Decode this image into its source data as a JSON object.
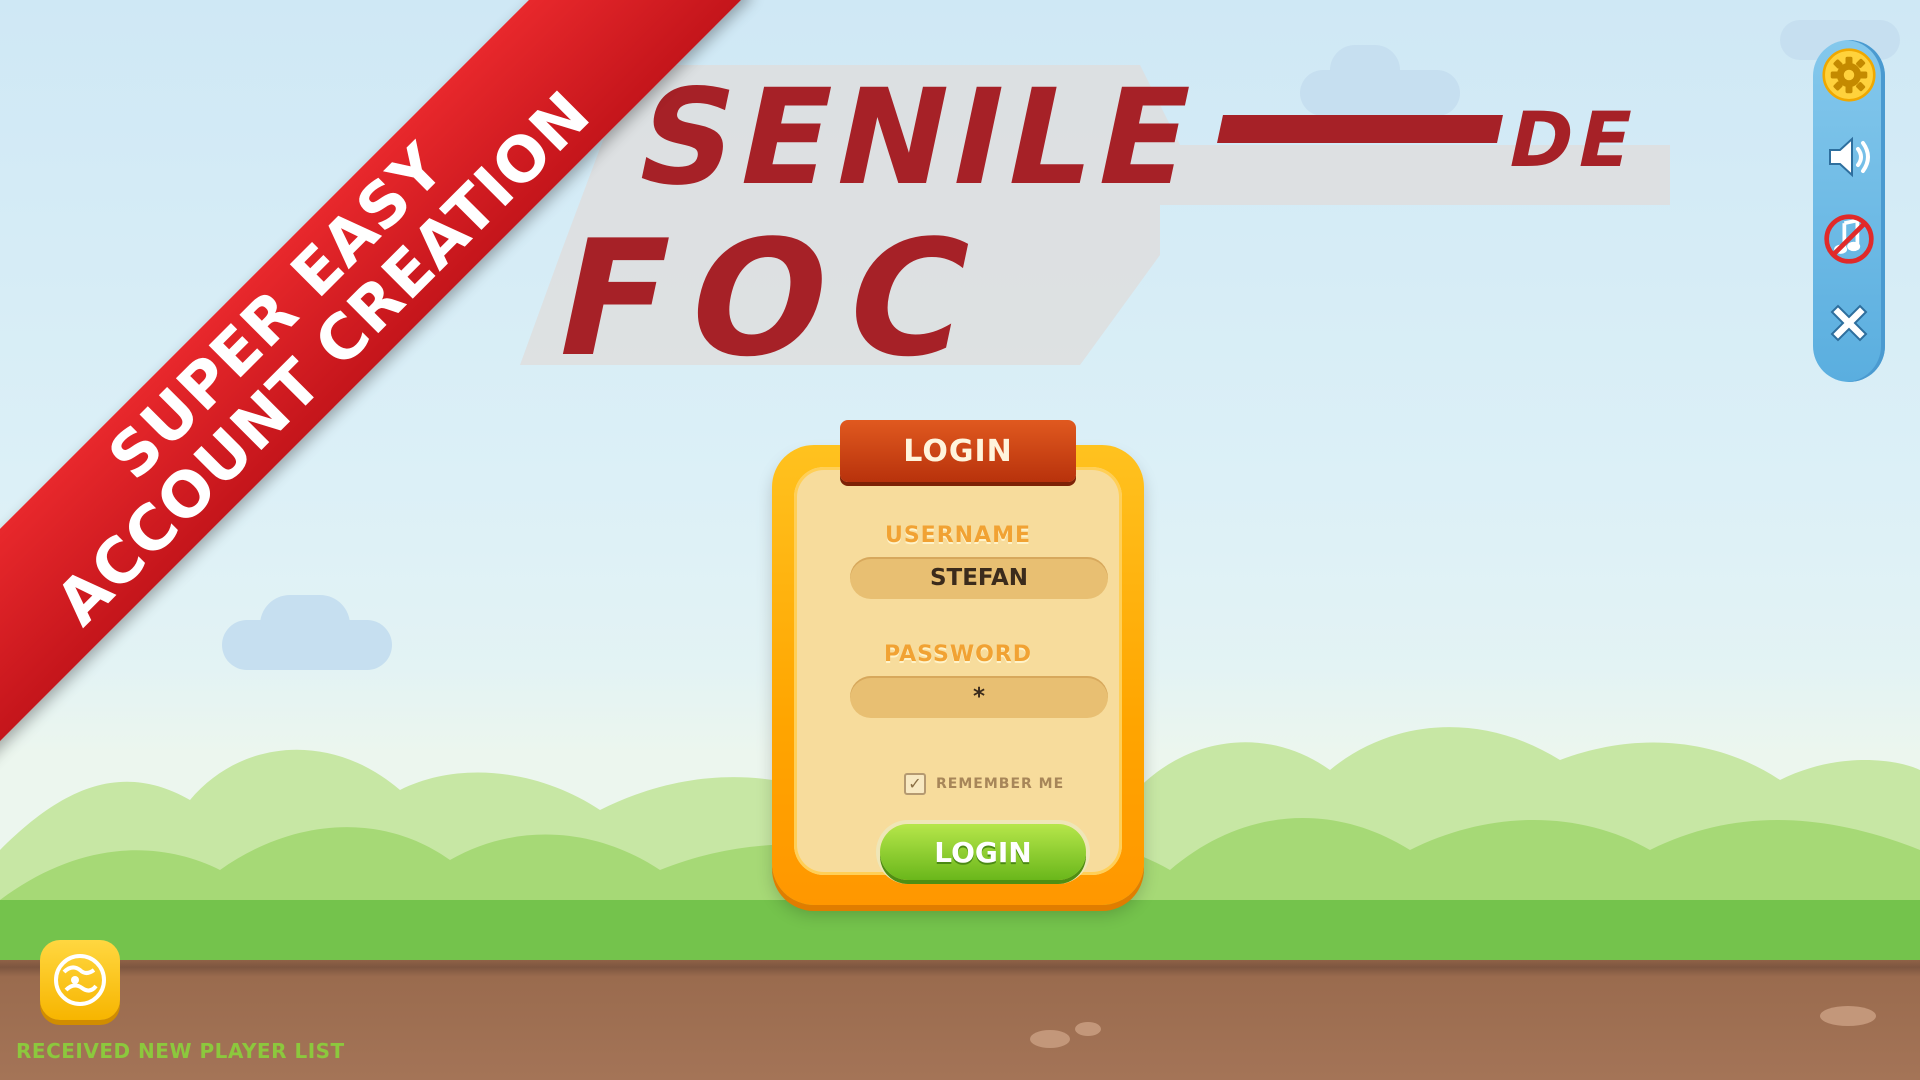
{
  "promo_banner": {
    "line1": "SUPER EASY",
    "line2": "ACCOUNT CREATION"
  },
  "game_logo": {
    "line1": "SENILE",
    "connector": "DE",
    "line2": "FOC"
  },
  "login_panel": {
    "title": "LOGIN",
    "username_label": "USERNAME",
    "username_value": "STEFAN",
    "password_label": "PASSWORD",
    "password_value": "*",
    "remember_label": "REMEMBER ME",
    "remember_checked": true,
    "login_button": "LOGIN"
  },
  "toolbar": {
    "icons": [
      "gear-icon",
      "speaker-icon",
      "music-muted-icon",
      "close-icon"
    ]
  },
  "status": {
    "message": "RECEIVED NEW PLAYER LIST"
  },
  "colors": {
    "ribbon": "#d81e24",
    "logo": "#a62127",
    "panel": "#ffa500",
    "login_button": "#7cc527",
    "toolbar": "#6cbbe6"
  }
}
